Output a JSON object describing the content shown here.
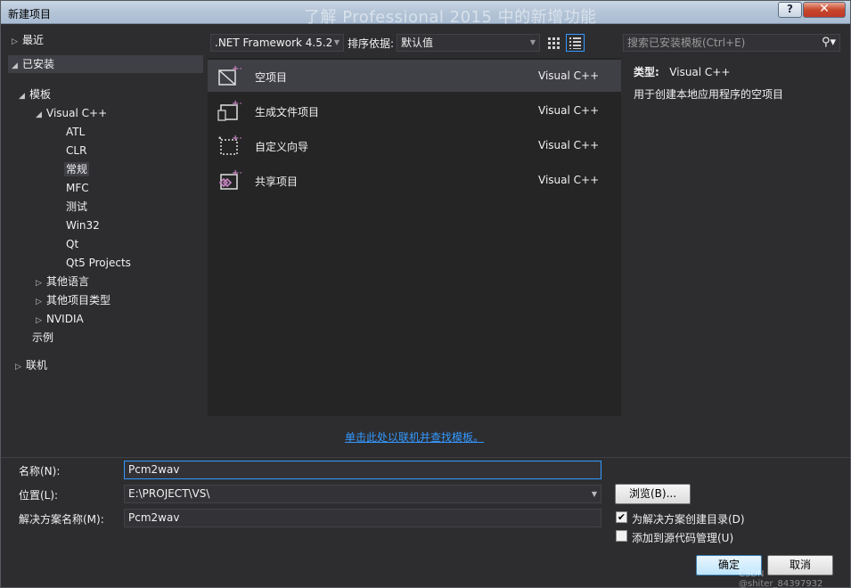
{
  "window": {
    "title": "新建项目",
    "background_title": "了解 Professional 2015 中的新增功能",
    "help_label": "?",
    "close_label": "✕"
  },
  "tree": {
    "recent": "最近",
    "installed": "已安装",
    "templates": "模板",
    "visual_cpp": "Visual C++",
    "children": [
      "ATL",
      "CLR",
      "常规",
      "MFC",
      "测试",
      "Win32",
      "Qt",
      "Qt5 Projects"
    ],
    "other_languages": "其他语言",
    "other_project_types": "其他项目类型",
    "nvidia": "NVIDIA",
    "samples": "示例",
    "online": "联机"
  },
  "toolbar": {
    "framework": ".NET Framework 4.5.2",
    "sort_label": "排序依据:",
    "sort_value": "默认值",
    "search_placeholder": "搜索已安装模板(Ctrl+E)"
  },
  "templates": [
    {
      "name": "空项目",
      "lang": "Visual C++",
      "icon": "empty-project-icon"
    },
    {
      "name": "生成文件项目",
      "lang": "Visual C++",
      "icon": "makefile-project-icon"
    },
    {
      "name": "自定义向导",
      "lang": "Visual C++",
      "icon": "custom-wizard-icon"
    },
    {
      "name": "共享项目",
      "lang": "Visual C++",
      "icon": "shared-project-icon"
    }
  ],
  "description": {
    "type_label": "类型:",
    "type_value": "Visual C++",
    "text": "用于创建本地应用程序的空项目"
  },
  "online_link": "单击此处以联机并查找模板。",
  "form": {
    "name_label": "名称(N):",
    "name_value": "Pcm2wav",
    "location_label": "位置(L):",
    "location_value": "E:\\PROJECT\\VS\\",
    "solution_label": "解决方案名称(M):",
    "solution_value": "Pcm2wav",
    "browse_label": "浏览(B)...",
    "create_dir_label": "为解决方案创建目录(D)",
    "create_dir_checked": true,
    "source_control_label": "添加到源代码管理(U)",
    "source_control_checked": false,
    "ok_label": "确定",
    "cancel_label": "取消"
  },
  "watermark": "CSDN @shiter_84397932",
  "colors": {
    "accent": "#3399ff",
    "dialog_bg": "#2d2d30",
    "list_bg": "#252526",
    "selection": "#3f3f46"
  }
}
